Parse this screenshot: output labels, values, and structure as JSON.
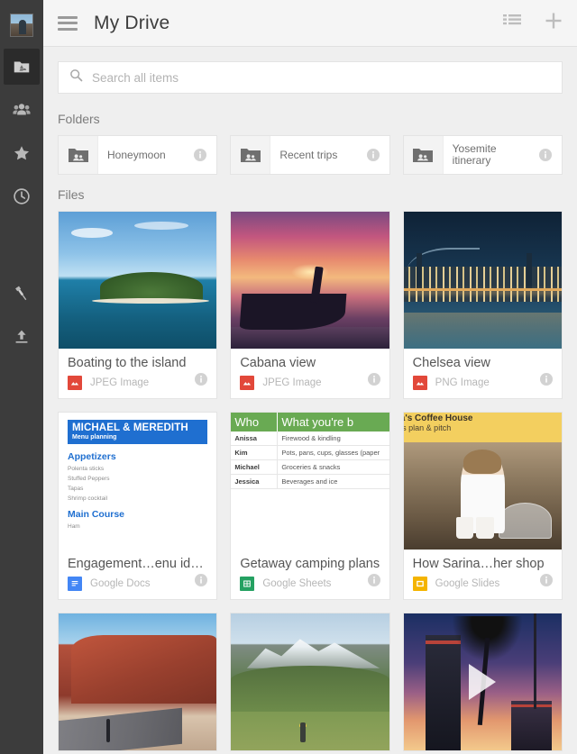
{
  "app": {
    "title": "My Drive",
    "accent": "#4386f5",
    "rail_bg": "#3c3c3c"
  },
  "rail": {
    "avatar_label": "user-avatar",
    "items": [
      {
        "name": "my-drive",
        "icon": "drive-folder-icon",
        "active": true
      },
      {
        "name": "shared-with-me",
        "icon": "people-icon",
        "active": false
      },
      {
        "name": "starred",
        "icon": "star-icon",
        "active": false
      },
      {
        "name": "recent",
        "icon": "clock-icon",
        "active": false
      },
      {
        "name": "pinned",
        "icon": "pin-icon",
        "active": false
      },
      {
        "name": "uploads",
        "icon": "upload-icon",
        "active": false
      }
    ]
  },
  "topbar": {
    "menu_icon": "hamburger-icon",
    "title": "My Drive",
    "actions": [
      {
        "name": "list-view",
        "icon": "list-view-icon"
      },
      {
        "name": "new-item",
        "icon": "plus-icon"
      }
    ]
  },
  "search": {
    "placeholder": "Search all items",
    "value": "",
    "icon": "search-icon"
  },
  "sections": {
    "folders_label": "Folders",
    "files_label": "Files"
  },
  "folders": [
    {
      "name": "Honeymoon",
      "icon": "shared-folder-icon",
      "info": "info-icon"
    },
    {
      "name": "Recent trips",
      "icon": "shared-folder-icon",
      "info": "info-icon"
    },
    {
      "name": "Yosemite itinerary",
      "icon": "shared-folder-icon",
      "info": "info-icon"
    }
  ],
  "files": [
    {
      "name": "Boating to the island",
      "type": "JPEG Image",
      "type_class": "img",
      "thumb": "island-photo",
      "info": "info-icon"
    },
    {
      "name": "Cabana view",
      "type": "JPEG Image",
      "type_class": "img",
      "thumb": "sunset-boat-photo",
      "info": "info-icon"
    },
    {
      "name": "Chelsea view",
      "type": "PNG Image",
      "type_class": "img",
      "thumb": "nyc-skyline-photo",
      "info": "info-icon"
    },
    {
      "name": "Engagement…enu ideas",
      "type": "Google Docs",
      "type_class": "doc",
      "thumb": "doc-preview",
      "info": "info-icon",
      "doc_preview": {
        "band_title": "MICHAEL & MEREDITH",
        "band_sub": "Menu planning",
        "heading1": "Appetizers",
        "items1": [
          "Polenta sticks",
          "Stuffed Peppers",
          "Tapas",
          "Shrimp cocktail"
        ],
        "heading2": "Main Course",
        "items2": [
          "Ham"
        ]
      }
    },
    {
      "name": "Getaway camping plans",
      "type": "Google Sheets",
      "type_class": "sheet",
      "thumb": "sheet-preview",
      "info": "info-icon",
      "sheet_preview": {
        "headers": [
          "Who",
          "What you're b"
        ],
        "rows": [
          [
            "Anissa",
            "Firewood & kindling"
          ],
          [
            "Kim",
            "Pots, pans, cups, glasses (paper"
          ],
          [
            "Michael",
            "Groceries & snacks"
          ],
          [
            "Jessica",
            "Beverages and ice"
          ]
        ]
      }
    },
    {
      "name": "How Sarina…her shop",
      "type": "Google Slides",
      "type_class": "slide",
      "thumb": "slide-preview",
      "info": "info-icon",
      "slide_preview": {
        "line1": "na's Coffee House",
        "line2": "ness plan & pitch"
      }
    },
    {
      "name": "",
      "type": "",
      "type_class": "img",
      "thumb": "canyon-photo",
      "info": "info-icon"
    },
    {
      "name": "",
      "type": "",
      "type_class": "img",
      "thumb": "mountain-cyclist-photo",
      "info": "info-icon"
    },
    {
      "name": "",
      "type": "",
      "type_class": "img",
      "thumb": "video-sunset-photo",
      "info": "info-icon",
      "has_play": true
    }
  ]
}
